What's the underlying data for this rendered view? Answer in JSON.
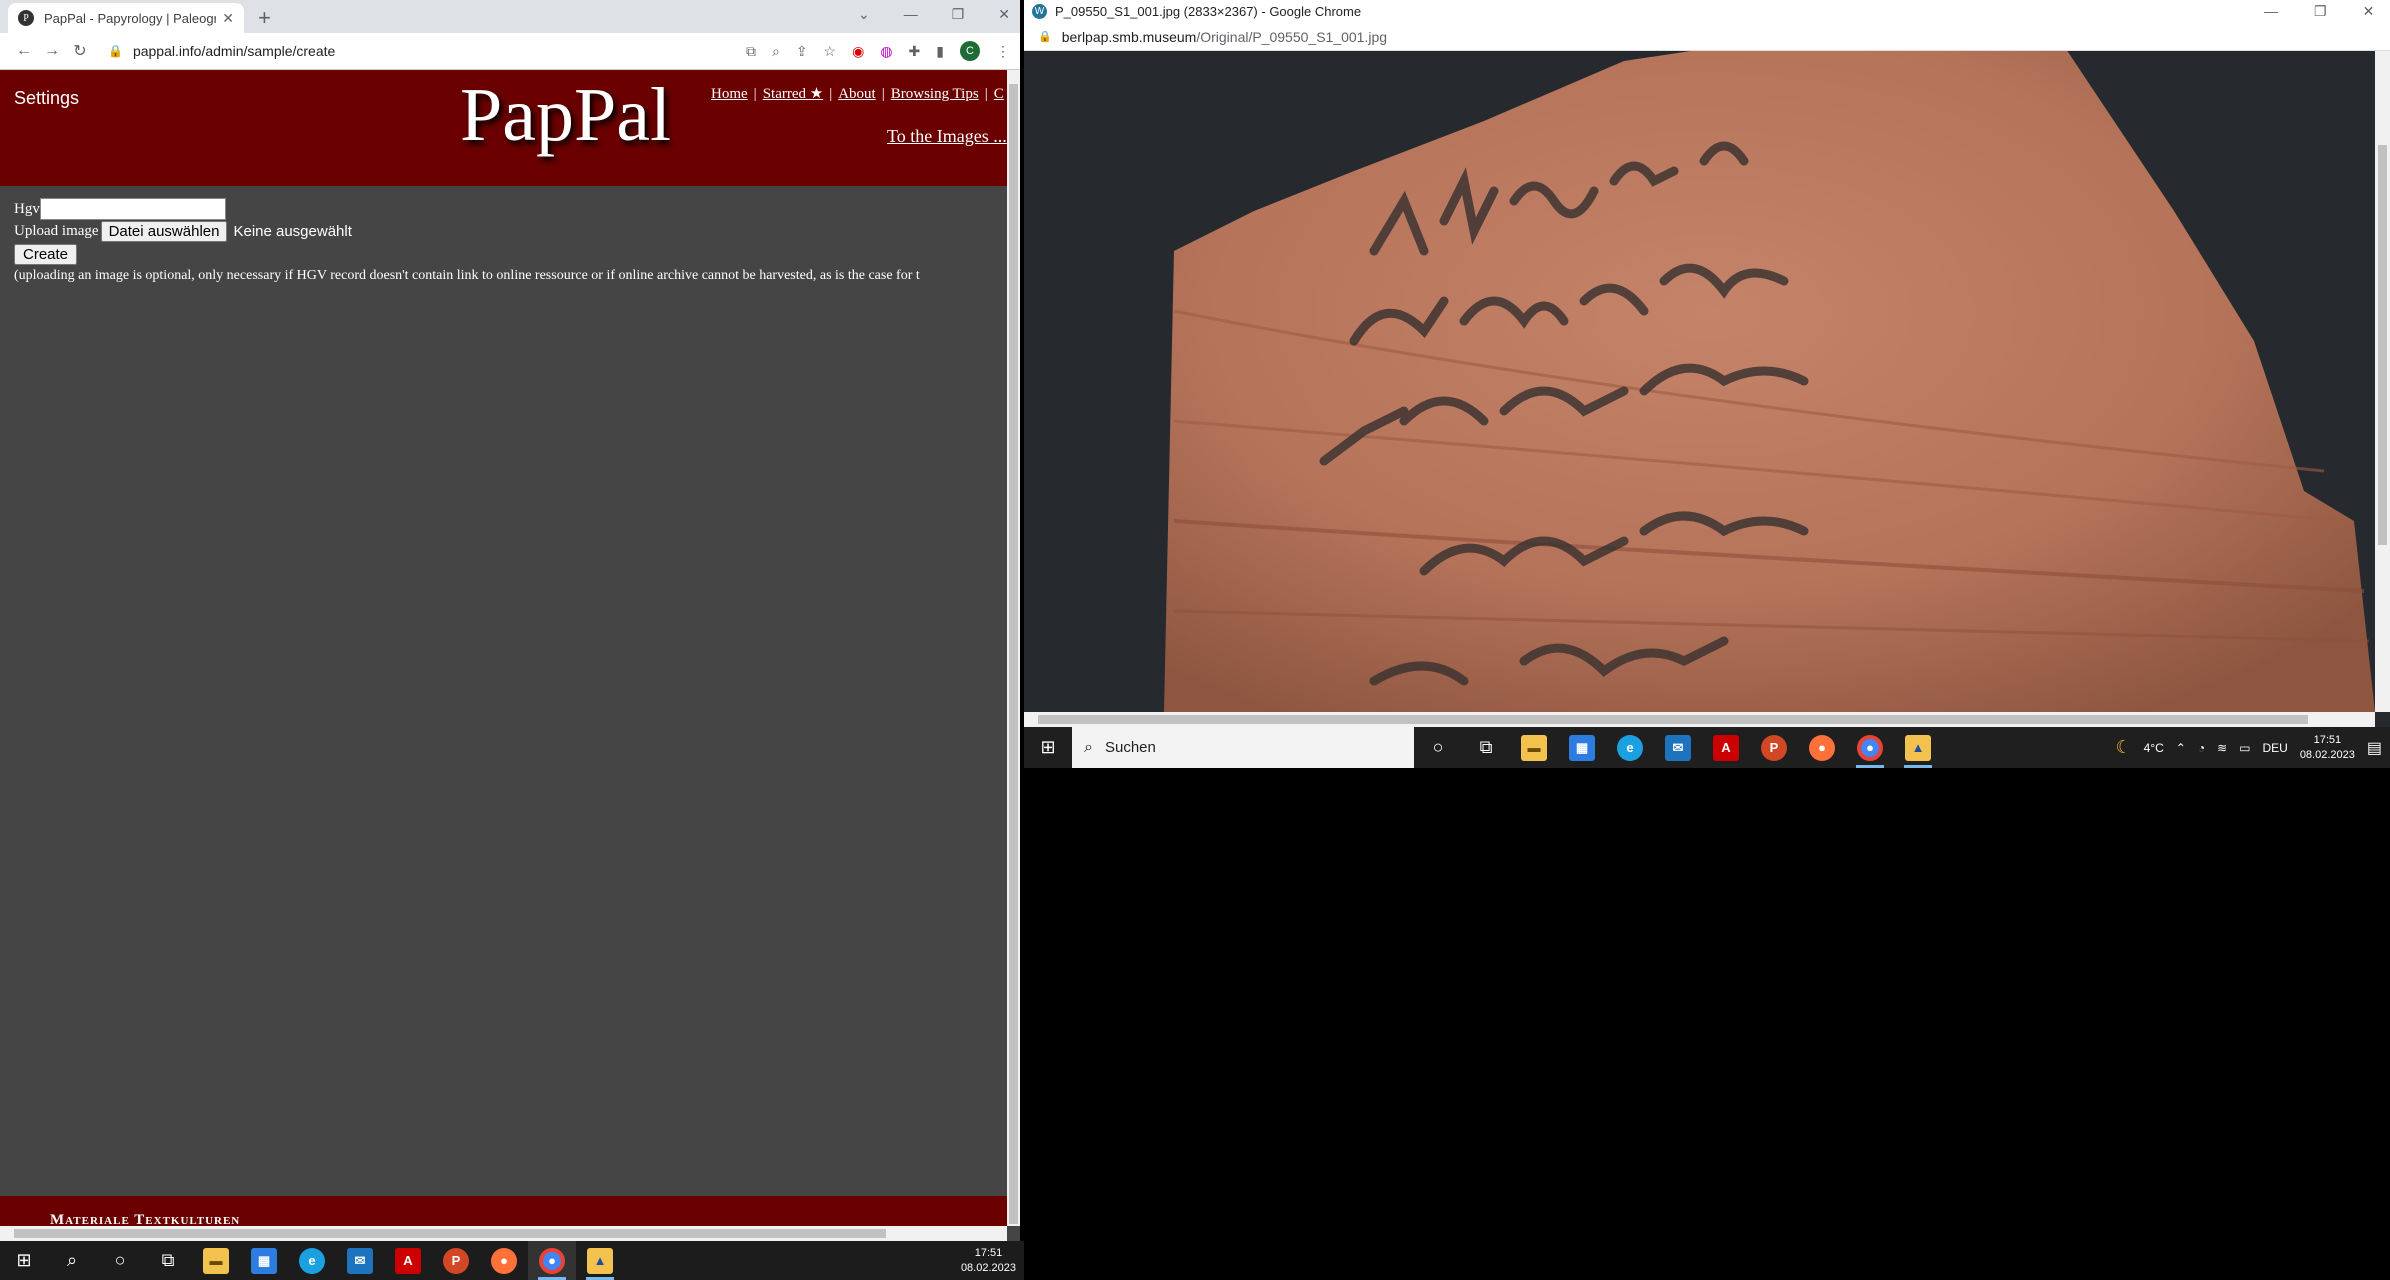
{
  "left_window": {
    "tab_title": "PapPal - Papyrology | Paleograph",
    "favicon": "P",
    "url": "pappal.info/admin/sample/create",
    "avatar_letter": "C",
    "header": {
      "settings_label": "Settings",
      "logo": "PapPal",
      "nav": [
        "Home",
        "Starred ★",
        "About",
        "Browsing Tips",
        "C"
      ],
      "to_images": "To the Images ..."
    },
    "form": {
      "hgv_label": "Hgv",
      "hgv_value": "",
      "upload_label": "Upload image",
      "file_button": "Datei auswählen",
      "file_status": "Keine ausgewählt",
      "create_button": "Create",
      "note": "(uploading an image is optional, only necessary if HGV record doesn't contain link to online ressource or if online archive cannot be harvested, as is the case for t"
    },
    "footer_text": "Materiale Textkulturen"
  },
  "right_window": {
    "title": "P_09550_S1_001.jpg (2833×2367) - Google Chrome",
    "url_host": "berlpap.smb.museum",
    "url_path": "/Original/P_09550_S1_001.jpg"
  },
  "taskbar_right": {
    "search_placeholder": "Suchen",
    "weather": "4°C",
    "language": "DEU",
    "time": "17:51",
    "date": "08.02.2023"
  },
  "taskbar_left": {
    "time": "17:51",
    "date": "08.02.2023"
  }
}
